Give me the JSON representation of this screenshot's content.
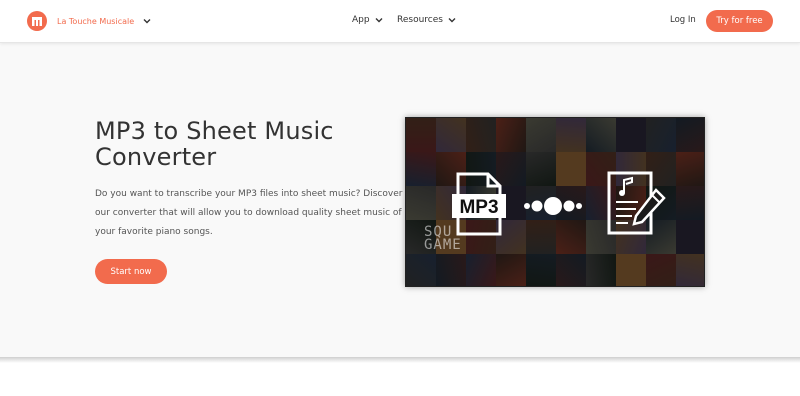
{
  "header": {
    "brand_name": "La Touche Musicale",
    "nav": [
      {
        "label": "App"
      },
      {
        "label": "Resources"
      }
    ],
    "login_label": "Log In",
    "cta_label": "Try for free"
  },
  "hero": {
    "title_line1": "MP3 to Sheet Music",
    "title_line2": "Converter",
    "description": "Do you want to transcribe your MP3 files into sheet music? Discover our converter that will allow you to download quality sheet music of your favorite piano songs.",
    "button_label": "Start now",
    "image": {
      "mp3_label": "MP3",
      "squid_text_line1": "SQU",
      "squid_text_line2": "GAME"
    }
  },
  "colors": {
    "accent": "#f26b4d"
  },
  "icons": [
    "logo-icon",
    "chevron-down-icon",
    "mp3-file-icon",
    "sheet-music-icon",
    "pen-icon"
  ]
}
